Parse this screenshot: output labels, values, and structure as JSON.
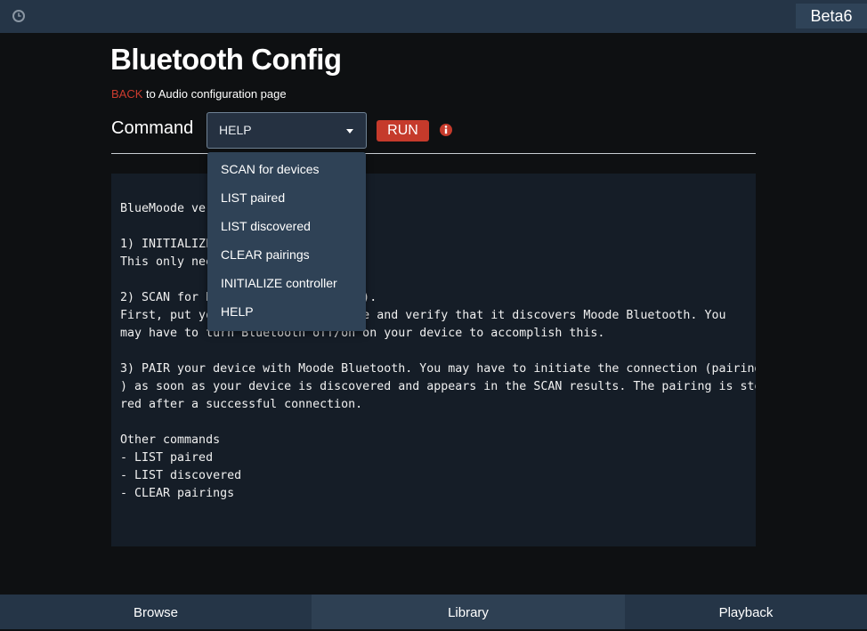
{
  "header": {
    "clock_icon": "clock-icon",
    "version": "Beta6"
  },
  "page": {
    "title": "Bluetooth Config",
    "back_link": "BACK",
    "back_text": " to Audio configuration page"
  },
  "command": {
    "label": "Command",
    "selected": "HELP",
    "run_label": "RUN",
    "info_icon": "info-icon",
    "options": [
      "SCAN for devices",
      "LIST paired",
      "LIST discovered",
      "CLEAR pairings",
      "INITIALIZE controller",
      "HELP"
    ]
  },
  "output": {
    "lines": [
      "BlueMoode ver",
      "",
      "1) INITIALIZE",
      "This only nee",
      "",
      "2) SCAN for B                  ecs).",
      "First, put yo                  mode and verify that it discovers Moode Bluetooth. You",
      "may have to turn Bluetooth off/on on your device to accomplish this.",
      "",
      "3) PAIR your device with Moode Bluetooth. You may have to initiate the connection (pairing",
      ") as soon as your device is discovered and appears in the SCAN results. The pairing is sto",
      "red after a successful connection.",
      "",
      "Other commands",
      "- LIST paired",
      "- LIST discovered",
      "- CLEAR pairings"
    ]
  },
  "footer": {
    "tabs": [
      "Browse",
      "Library",
      "Playback"
    ],
    "active_tab": "Library"
  },
  "colors": {
    "accent_red": "#cc3b2e",
    "bar_bg": "#253547",
    "page_bg": "#0e1012",
    "console_bg": "#151d27"
  }
}
